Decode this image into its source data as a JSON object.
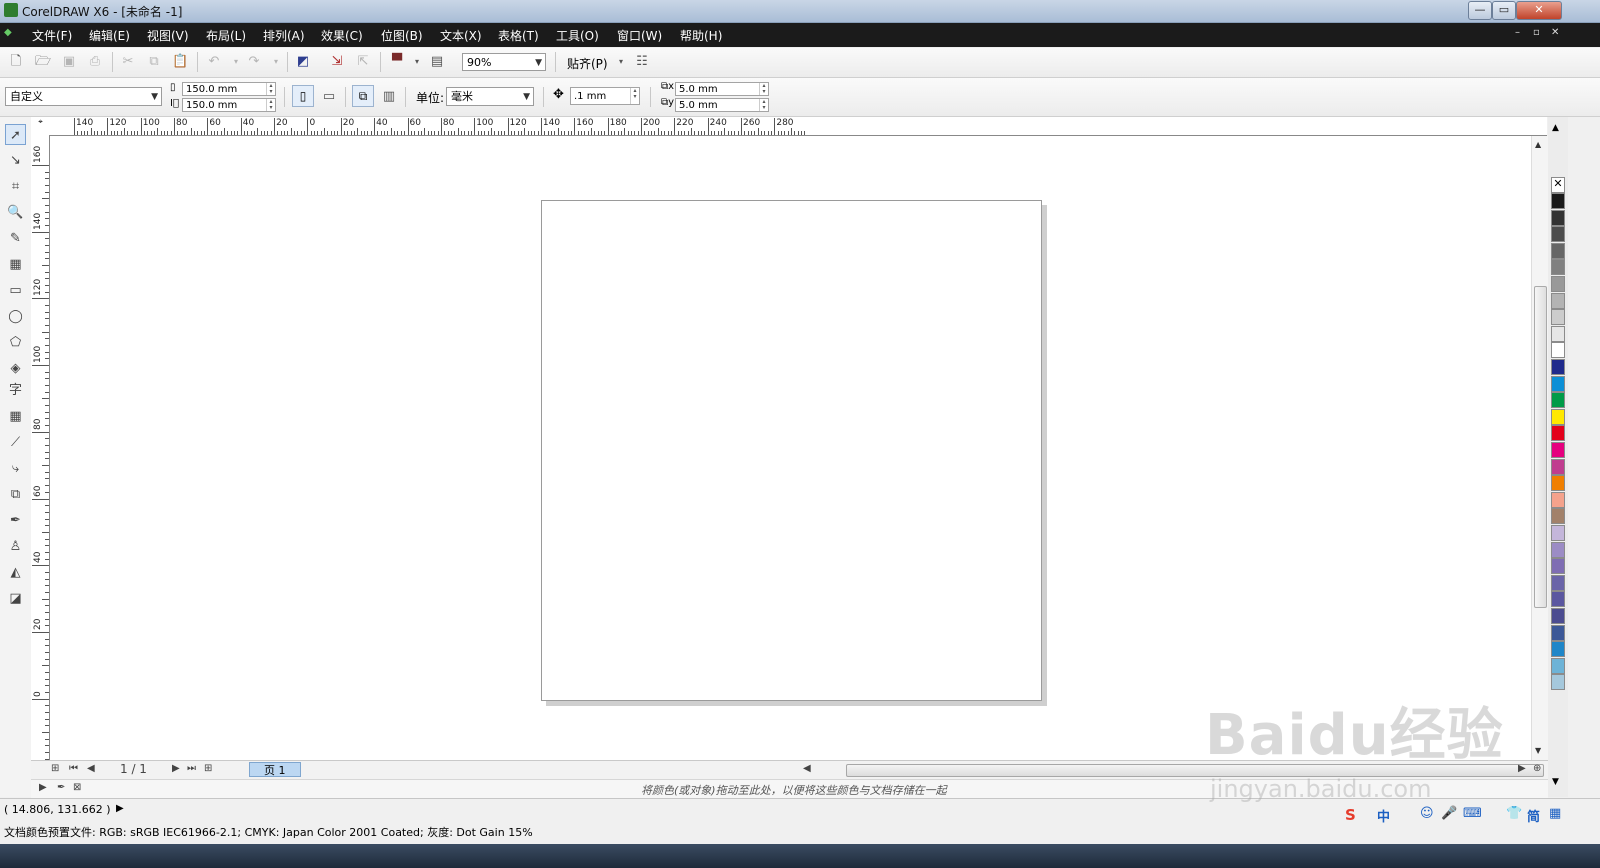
{
  "window": {
    "title": "CorelDRAW X6 - [未命名 -1]",
    "minimize": "—",
    "maximize": "▭",
    "close": "✕"
  },
  "menu": {
    "items": [
      "文件(F)",
      "编辑(E)",
      "视图(V)",
      "布局(L)",
      "排列(A)",
      "效果(C)",
      "位图(B)",
      "文本(X)",
      "表格(T)",
      "工具(O)",
      "窗口(W)",
      "帮助(H)"
    ]
  },
  "standard_toolbar": {
    "zoom": "90%",
    "snap_label": "贴齐(P)"
  },
  "property_bar": {
    "page_preset": "自定义",
    "width": "150.0 mm",
    "height": "150.0 mm",
    "unit_label": "单位:",
    "unit_value": "毫米",
    "nudge": ".1 mm",
    "dup_x": "5.0 mm",
    "dup_y": "5.0 mm"
  },
  "rulers": {
    "horizontal_labels": [
      "140",
      "120",
      "100",
      "80",
      "60",
      "40",
      "20",
      "0",
      "20",
      "40",
      "60",
      "80",
      "100",
      "120",
      "140",
      "160",
      "180",
      "200",
      "220",
      "240",
      "260",
      "280"
    ],
    "vertical_labels": [
      "160",
      "140",
      "120",
      "100",
      "80",
      "60",
      "40",
      "20",
      "0"
    ]
  },
  "page_nav": {
    "counter": "1 / 1",
    "tab_label": "页 1"
  },
  "doc_palette": {
    "hint": "将颜色(或对象)拖动至此处，以便将这些颜色与文档存储在一起"
  },
  "status": {
    "coords": "( 14.806, 131.662 )",
    "color_profile": "文档颜色预置文件: RGB: sRGB IEC61966-2.1; CMYK: Japan Color 2001 Coated; 灰度: Dot Gain 15%"
  },
  "palette_colors": [
    "#1a1a1a",
    "#333333",
    "#4d4d4d",
    "#666666",
    "#808080",
    "#999999",
    "#b3b3b3",
    "#cccccc",
    "#e6e6e6",
    "#ffffff",
    "#1f2a8c",
    "#0c8fd6",
    "#009b48",
    "#ffe800",
    "#e3001b",
    "#e5007e",
    "#c03d8f",
    "#f07f00",
    "#f4a28c",
    "#a2816a",
    "#c4b6da",
    "#9c8cc5",
    "#7f6db3",
    "#6a64a8",
    "#5b57a0",
    "#4c4c90",
    "#3c5897",
    "#1f86c8",
    "#6db3d7",
    "#a5c8dc"
  ],
  "ime": {
    "chinese": "中",
    "simplified": "简"
  },
  "watermark": {
    "logo": "Baidu经验",
    "url": "jingyan.baidu.com"
  }
}
